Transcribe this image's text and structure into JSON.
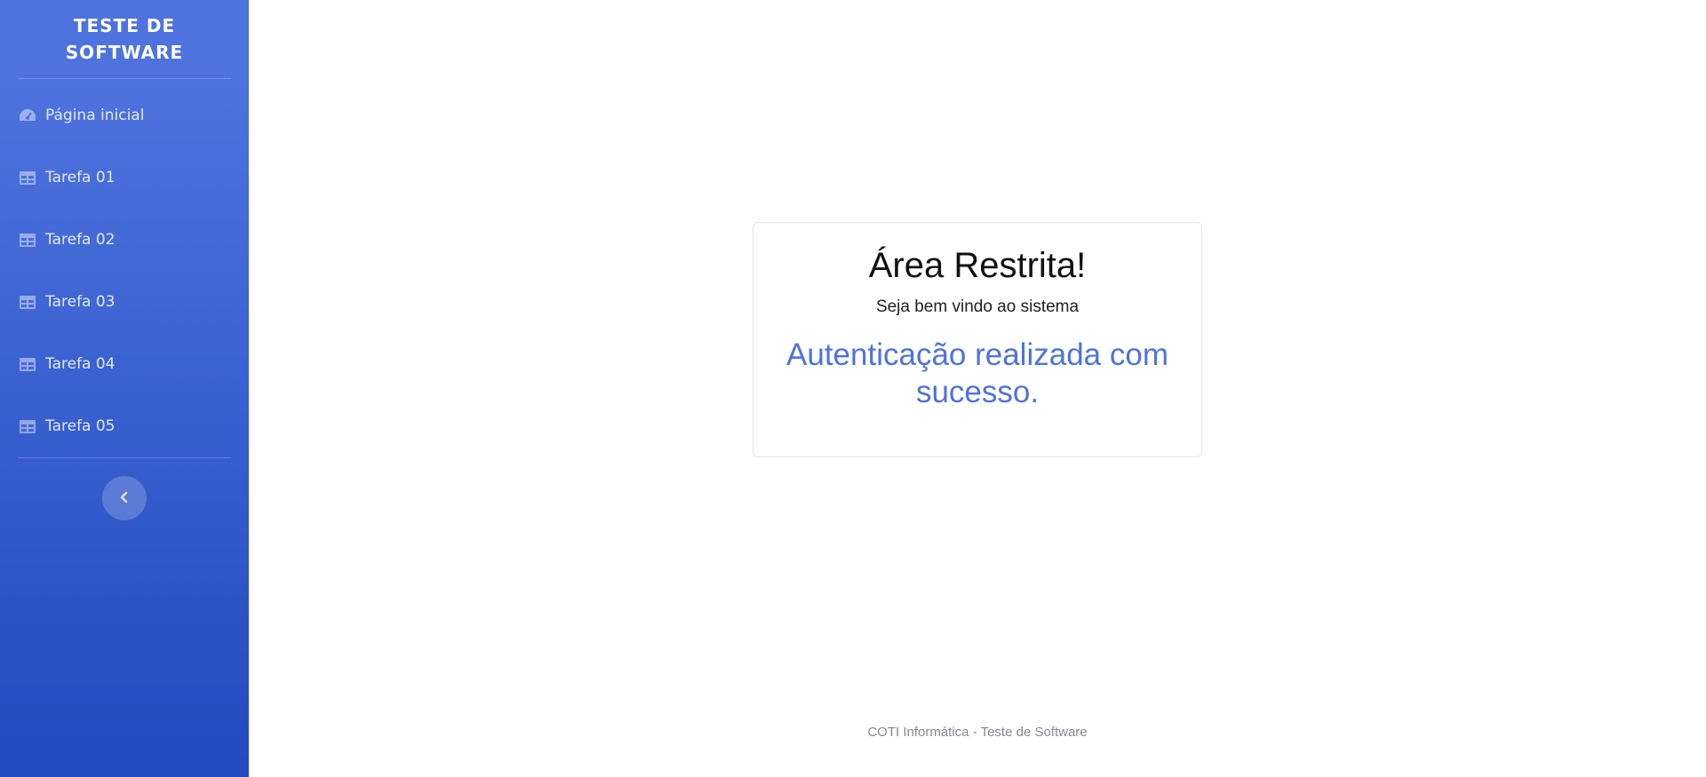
{
  "sidebar": {
    "brand": "TESTE DE SOFTWARE",
    "items": [
      {
        "label": "Página inicial",
        "icon": "tachometer-icon"
      },
      {
        "label": "Tarefa 01",
        "icon": "table-icon"
      },
      {
        "label": "Tarefa 02",
        "icon": "table-icon"
      },
      {
        "label": "Tarefa 03",
        "icon": "table-icon"
      },
      {
        "label": "Tarefa 04",
        "icon": "table-icon"
      },
      {
        "label": "Tarefa 05",
        "icon": "table-icon"
      }
    ],
    "toggle_icon": "chevron-left-icon",
    "gradient_top": "#4e73df",
    "gradient_bottom": "#224abe"
  },
  "card": {
    "title": "Área Restrita!",
    "subtitle": "Seja bem vindo ao sistema",
    "message": "Autenticação realizada com sucesso.",
    "message_color": "#4e73df"
  },
  "footer": {
    "text": "COTI Informática - Teste de Software"
  }
}
